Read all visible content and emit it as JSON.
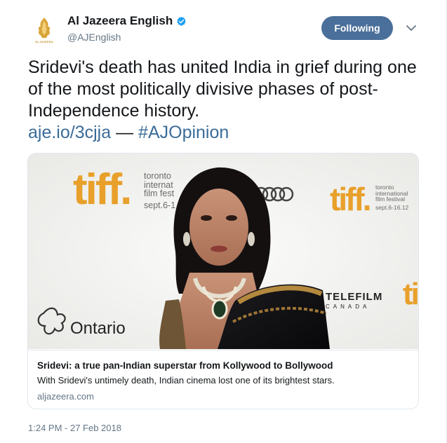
{
  "account": {
    "display_name": "Al Jazeera English",
    "handle": "@AJEnglish",
    "logo_text": "ALJAZEERA",
    "verified": true
  },
  "follow_button": {
    "label": "Following"
  },
  "menu": {
    "icon": "chevron-down-icon"
  },
  "tweet": {
    "text": "Sridevi's death has united India in grief during one of the most politically divisive phases of post-Independence history.",
    "link": "aje.io/3cjja",
    "separator": "—",
    "hashtag": "#AJOpinion",
    "timestamp": "1:24 PM - 27 Feb 2018"
  },
  "card": {
    "image_backdrop": {
      "tiff_logo": "tiff.",
      "tiff_lines_left": [
        "toronto",
        "internat",
        "film fest",
        "sept.6-1"
      ],
      "tiff_lines_right": [
        "toronto",
        "international",
        "film festival",
        "sept.6-16.12"
      ],
      "telefilm": "TELEFILM",
      "canada": "CANADA",
      "ontario": "Ontario",
      "partial_right": "ti"
    },
    "title": "Sridevi: a true pan-Indian superstar from Kollywood to Bollywood",
    "description": "With Sridevi's untimely death, Indian cinema lost one of its brightest stars.",
    "domain": "aljazeera.com"
  },
  "colors": {
    "follow_button": "#4a6f9a",
    "link": "#3b6c99",
    "tiff_orange": "#e8a02b",
    "verified_blue": "#1da1f2",
    "secondary_text": "#657786"
  }
}
